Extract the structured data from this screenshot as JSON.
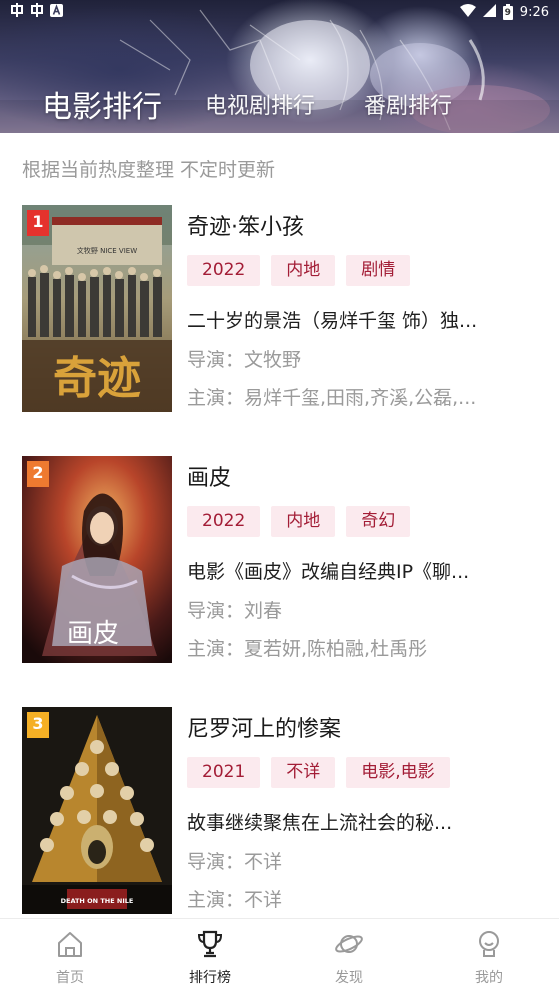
{
  "status_bar": {
    "left_icons": [
      "app-notification-icon",
      "app-notification-icon",
      "a-icon"
    ],
    "time": "9:26",
    "battery_level": "9"
  },
  "tabs": [
    {
      "label": "电影排行",
      "active": true
    },
    {
      "label": "电视剧排行",
      "active": false
    },
    {
      "label": "番剧排行",
      "active": false
    }
  ],
  "subtitle": "根据当前热度整理 不定时更新",
  "items": [
    {
      "rank": "1",
      "title": "奇迹·笨小孩",
      "tags": [
        "2022",
        "内地",
        "剧情"
      ],
      "desc": "二十岁的景浩（易烊千玺 饰）独...",
      "director": "导演：文牧野",
      "actors": "主演：易烊千玺,田雨,齐溪,公磊,..."
    },
    {
      "rank": "2",
      "title": "画皮",
      "tags": [
        "2022",
        "内地",
        "奇幻"
      ],
      "desc": "电影《画皮》改编自经典IP《聊...",
      "director": "导演：刘春",
      "actors": "主演：夏若妍,陈柏融,杜禹彤"
    },
    {
      "rank": "3",
      "title": "尼罗河上的惨案",
      "tags": [
        "2021",
        "不详",
        "电影,电影"
      ],
      "desc": "故事继续聚焦在上流社会的秘...",
      "director": "导演：不详",
      "actors": "主演：不详"
    }
  ],
  "posters": {
    "1": {
      "logo_text": "奇迹",
      "caption": "文牧野 NICE VIEW"
    },
    "2": {
      "logo_text": "画皮"
    },
    "3": {
      "caption": "DEATH ON THE NILE"
    }
  },
  "bottom_nav": [
    {
      "label": "首页",
      "icon": "home-icon",
      "active": false
    },
    {
      "label": "排行榜",
      "icon": "trophy-icon",
      "active": true
    },
    {
      "label": "发现",
      "icon": "planet-icon",
      "active": false
    },
    {
      "label": "我的",
      "icon": "profile-icon",
      "active": false
    }
  ],
  "colors": {
    "tag_bg": "#fbeaee",
    "tag_text": "#a31d36",
    "rank_1": "#e5322d",
    "rank_2": "#ee7a30",
    "rank_3": "#f5b025"
  }
}
